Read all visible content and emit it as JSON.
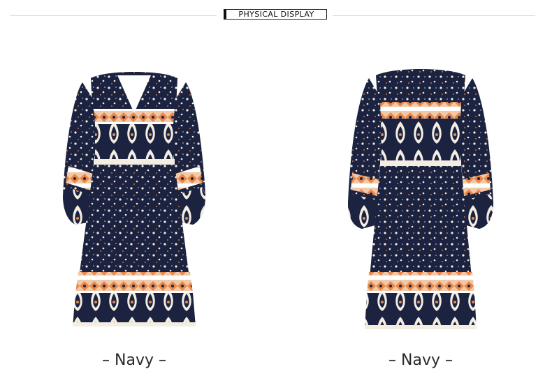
{
  "header": {
    "title": "PHYSICAL DISPLAY"
  },
  "gallery": [
    {
      "caption": "– Navy –"
    },
    {
      "caption": "– Navy –"
    }
  ],
  "colors": {
    "navy": "#1c2340",
    "orange": "#e8874a",
    "peach": "#f1c9a8",
    "cream": "#f3ede2"
  }
}
